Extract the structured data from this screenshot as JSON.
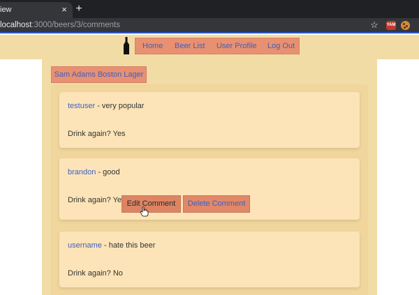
{
  "browser": {
    "tab_title": "iew",
    "tab_close": "×",
    "new_tab": "+",
    "url_host": "localhost",
    "url_path": ":3000/beers/3/comments",
    "star": "☆",
    "ext1": "YAM"
  },
  "nav": {
    "home": "Home",
    "beer_list": "Beer List",
    "user_profile": "User Profile",
    "log_out": "Log Out"
  },
  "beer": {
    "name": "Sam Adams Boston Lager"
  },
  "comments": [
    {
      "user": "testuser",
      "text": " - very popular",
      "drink_again": "Drink again? Yes"
    },
    {
      "user": "brandon",
      "text": " - good",
      "drink_again": "Drink again? Yes"
    },
    {
      "user": "username",
      "text": " - hate this beer",
      "drink_again": "Drink again? No"
    }
  ],
  "actions": {
    "edit": "Edit Comment",
    "delete": "Delete Comment"
  },
  "colors": {
    "header_bg": "#f2dca5",
    "button_bg": "#e89070",
    "link": "#3d5fc4",
    "card_bg": "#fce4b8"
  }
}
